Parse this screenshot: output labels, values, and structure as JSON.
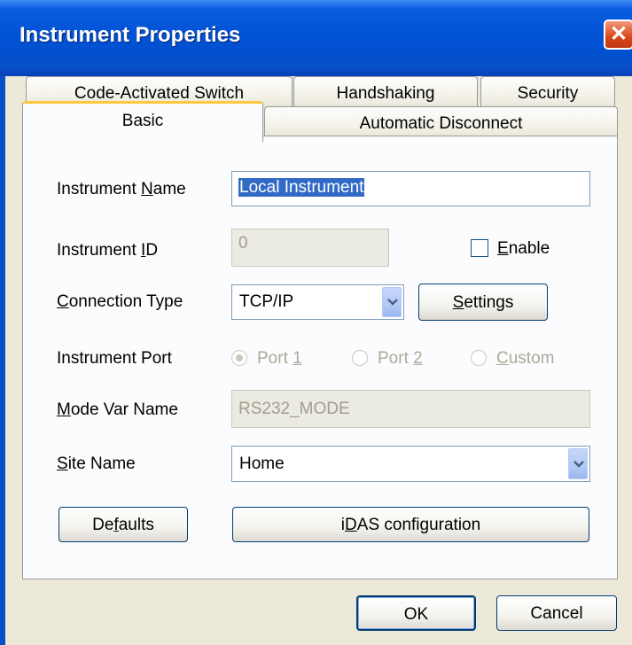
{
  "window": {
    "title": "Instrument Properties",
    "close_glyph": "✕"
  },
  "tabs": {
    "row1": [
      "Code-Activated Switch",
      "Handshaking",
      "Security"
    ],
    "row2": [
      "Basic",
      "Automatic Disconnect"
    ],
    "active": "Basic"
  },
  "fields": {
    "instrument_name": {
      "label_pre": "Instrument ",
      "label_ul": "N",
      "label_post": "ame",
      "value": "Local Instrument"
    },
    "instrument_id": {
      "label_pre": "Instrument ",
      "label_ul": "I",
      "label_post": "D",
      "value": "0"
    },
    "enable": {
      "label_ul": "E",
      "label_post": "nable",
      "checked": false
    },
    "connection_type": {
      "label_ul": "C",
      "label_post": "onnection Type",
      "value": "TCP/IP"
    },
    "settings_button": {
      "label_ul": "S",
      "label_post": "ettings"
    },
    "instrument_port": {
      "label": "Instrument Port",
      "options": [
        {
          "pre": "Port ",
          "ul": "1",
          "post": "",
          "selected": true
        },
        {
          "pre": "Port ",
          "ul": "2",
          "post": "",
          "selected": false
        },
        {
          "pre": "",
          "ul": "C",
          "post": "ustom",
          "selected": false
        }
      ]
    },
    "mode_var_name": {
      "label_ul": "M",
      "label_post": "ode Var Name",
      "value": "RS232_MODE"
    },
    "site_name": {
      "label_ul": "S",
      "label_post": "ite Name",
      "value": "Home"
    }
  },
  "buttons": {
    "defaults": {
      "pre": "De",
      "ul": "f",
      "post": "aults"
    },
    "idas": {
      "pre": "i",
      "ul": "D",
      "post": "AS configuration"
    },
    "ok": "OK",
    "cancel": "Cancel"
  },
  "colors": {
    "titlebar": "#0354d6",
    "selection": "#316ac5",
    "tab_highlight": "#ffc83c",
    "panel": "#fcfcfe",
    "dialog": "#ece9d8"
  }
}
